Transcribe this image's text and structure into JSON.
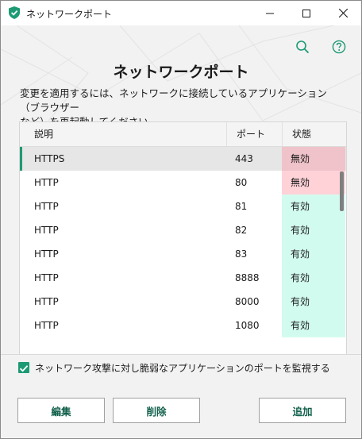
{
  "window": {
    "title": "ネットワークポート",
    "minimize_icon": "minimize-icon",
    "maximize_icon": "maximize-icon",
    "close_icon": "close-icon"
  },
  "toolbar": {
    "search_icon": "search-icon",
    "help_icon": "help-icon"
  },
  "main": {
    "heading": "ネットワークポート",
    "description_line1": "変更を適用するには、ネットワークに接続しているアプリケーション（ブラウザー",
    "description_line2": "など）を再起動してください。"
  },
  "table": {
    "columns": [
      "説明",
      "ポート",
      "状態"
    ],
    "rows": [
      {
        "desc": "HTTPS",
        "port": "443",
        "status": "無効",
        "enabled": false,
        "selected": true
      },
      {
        "desc": "HTTP",
        "port": "80",
        "status": "無効",
        "enabled": false,
        "selected": false
      },
      {
        "desc": "HTTP",
        "port": "81",
        "status": "有効",
        "enabled": true,
        "selected": false
      },
      {
        "desc": "HTTP",
        "port": "82",
        "status": "有効",
        "enabled": true,
        "selected": false
      },
      {
        "desc": "HTTP",
        "port": "83",
        "status": "有効",
        "enabled": true,
        "selected": false
      },
      {
        "desc": "HTTP",
        "port": "8888",
        "status": "有効",
        "enabled": true,
        "selected": false
      },
      {
        "desc": "HTTP",
        "port": "8000",
        "status": "有効",
        "enabled": true,
        "selected": false
      },
      {
        "desc": "HTTP",
        "port": "1080",
        "status": "有効",
        "enabled": true,
        "selected": false
      }
    ]
  },
  "footer": {
    "checkbox_label": "ネットワーク攻撃に対し脆弱なアプリケーションのポートを監視する",
    "checkbox_checked": true,
    "edit_label": "編集",
    "delete_label": "削除",
    "add_label": "追加"
  },
  "colors": {
    "accent": "#1d9a74",
    "button_text": "#0f5f4a",
    "status_disabled_bg": "#ffd2d8",
    "status_enabled_bg": "#d2fbef"
  }
}
